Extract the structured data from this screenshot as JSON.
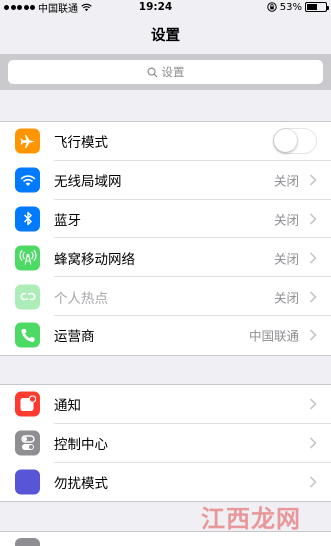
{
  "status": {
    "carrier": "中国联通",
    "time": "19:24",
    "battery": "53%",
    "battery_level": 0.53
  },
  "nav": {
    "title": "设置"
  },
  "search": {
    "placeholder": "设置"
  },
  "section1": [
    {
      "label": "飞行模式",
      "type": "toggle",
      "on": false,
      "icon": "airplane-icon",
      "color": "#ff9500"
    },
    {
      "label": "无线局域网",
      "value": "关闭",
      "icon": "wifi-icon",
      "color": "#007aff"
    },
    {
      "label": "蓝牙",
      "value": "关闭",
      "icon": "bluetooth-icon",
      "color": "#007aff"
    },
    {
      "label": "蜂窝移动网络",
      "value": "关闭",
      "icon": "cellular-icon",
      "color": "#4cd964"
    },
    {
      "label": "个人热点",
      "value": "关闭",
      "icon": "hotspot-icon",
      "color": "#4cd964",
      "disabled": true
    },
    {
      "label": "运营商",
      "value": "中国联通",
      "icon": "phone-icon",
      "color": "#4cd964"
    }
  ],
  "section2": [
    {
      "label": "通知",
      "icon": "notifications-icon",
      "color": "#ff3b30"
    },
    {
      "label": "控制中心",
      "icon": "control-center-icon",
      "color": "#8e8e93"
    },
    {
      "label": "勿扰模式",
      "icon": "moon-icon",
      "color": "#5856d6"
    }
  ],
  "watermark": "江西龙网"
}
